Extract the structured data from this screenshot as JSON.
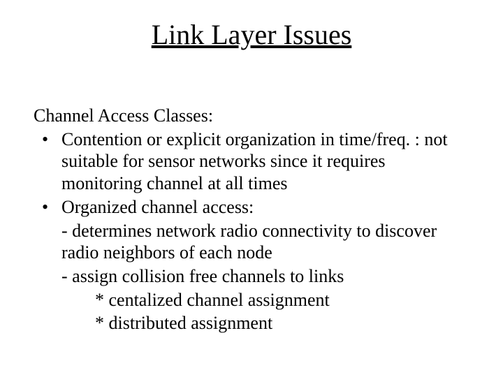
{
  "title": "Link Layer Issues",
  "lead": "Channel Access Classes:",
  "bullets": [
    {
      "text": "Contention or explicit organization in time/freq. : not suitable for sensor networks since it requires monitoring channel at all times"
    },
    {
      "text": "Organized channel access:",
      "dashes": [
        "- determines network radio connectivity to discover radio neighbors of each node",
        "- assign collision free channels to links"
      ],
      "stars": [
        "* centalized channel assignment",
        "* distributed assignment"
      ]
    }
  ]
}
